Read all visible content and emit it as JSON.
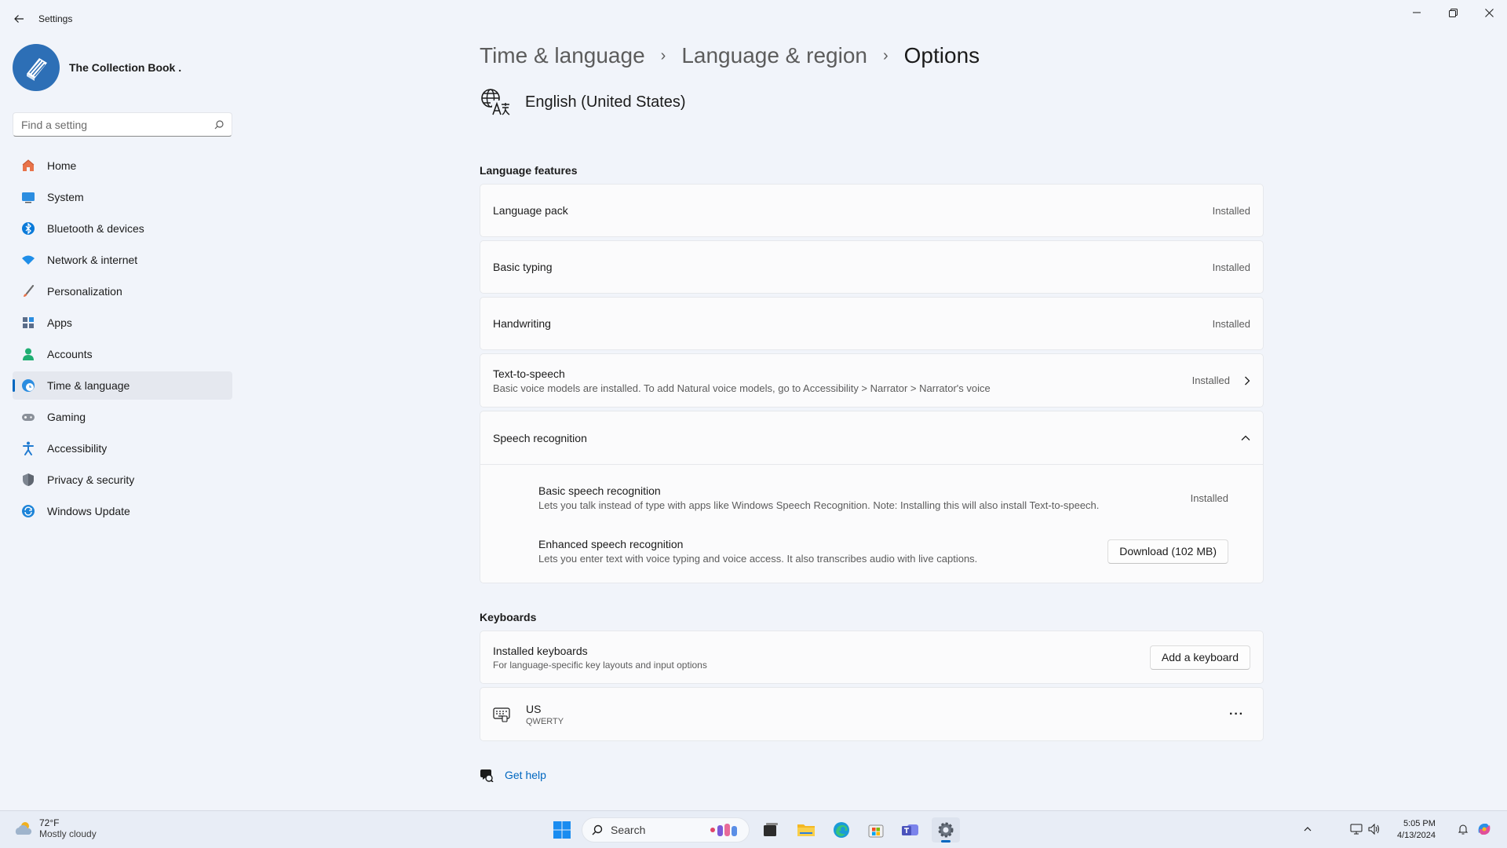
{
  "window": {
    "title": "Settings"
  },
  "profile": {
    "name": "The Collection Book ."
  },
  "search": {
    "placeholder": "Find a setting"
  },
  "nav": {
    "items": [
      {
        "label": "Home",
        "icon": "home-icon"
      },
      {
        "label": "System",
        "icon": "system-icon"
      },
      {
        "label": "Bluetooth & devices",
        "icon": "bluetooth-icon"
      },
      {
        "label": "Network & internet",
        "icon": "wifi-icon"
      },
      {
        "label": "Personalization",
        "icon": "brush-icon"
      },
      {
        "label": "Apps",
        "icon": "apps-icon"
      },
      {
        "label": "Accounts",
        "icon": "accounts-icon"
      },
      {
        "label": "Time & language",
        "icon": "time-language-icon",
        "active": true
      },
      {
        "label": "Gaming",
        "icon": "gamepad-icon"
      },
      {
        "label": "Accessibility",
        "icon": "accessibility-icon"
      },
      {
        "label": "Privacy & security",
        "icon": "shield-icon"
      },
      {
        "label": "Windows Update",
        "icon": "update-icon"
      }
    ]
  },
  "breadcrumb": {
    "level1": "Time & language",
    "level2": "Language & region",
    "current": "Options",
    "separator": "›"
  },
  "language": {
    "name": "English (United States)"
  },
  "language_features": {
    "title": "Language features",
    "language_pack": {
      "label": "Language pack",
      "status": "Installed"
    },
    "basic_typing": {
      "label": "Basic typing",
      "status": "Installed"
    },
    "handwriting": {
      "label": "Handwriting",
      "status": "Installed"
    },
    "text_to_speech": {
      "label": "Text-to-speech",
      "description": "Basic voice models are installed. To add Natural voice models, go to Accessibility > Narrator > Narrator's voice",
      "status": "Installed"
    },
    "speech_recognition": {
      "label": "Speech recognition",
      "basic": {
        "label": "Basic speech recognition",
        "description": "Lets you talk instead of type with apps like Windows Speech Recognition. Note: Installing this will also install Text-to-speech.",
        "status": "Installed"
      },
      "enhanced": {
        "label": "Enhanced speech recognition",
        "description": "Lets you enter text with voice typing and voice access. It also transcribes audio with live captions.",
        "button": "Download (102 MB)"
      }
    }
  },
  "keyboards": {
    "title": "Keyboards",
    "installed": {
      "label": "Installed keyboards",
      "description": "For language-specific key layouts and input options",
      "button": "Add a keyboard"
    },
    "us": {
      "name": "US",
      "layout": "QWERTY",
      "more": "···"
    }
  },
  "help": {
    "label": "Get help"
  },
  "taskbar": {
    "weather_temp": "72°F",
    "weather_condition": "Mostly cloudy",
    "search_label": "Search",
    "time": "5:05 PM",
    "date": "4/13/2024"
  },
  "colors": {
    "accent": "#0067c0",
    "background": "#f1f4fa",
    "card": "#fbfbfc"
  }
}
